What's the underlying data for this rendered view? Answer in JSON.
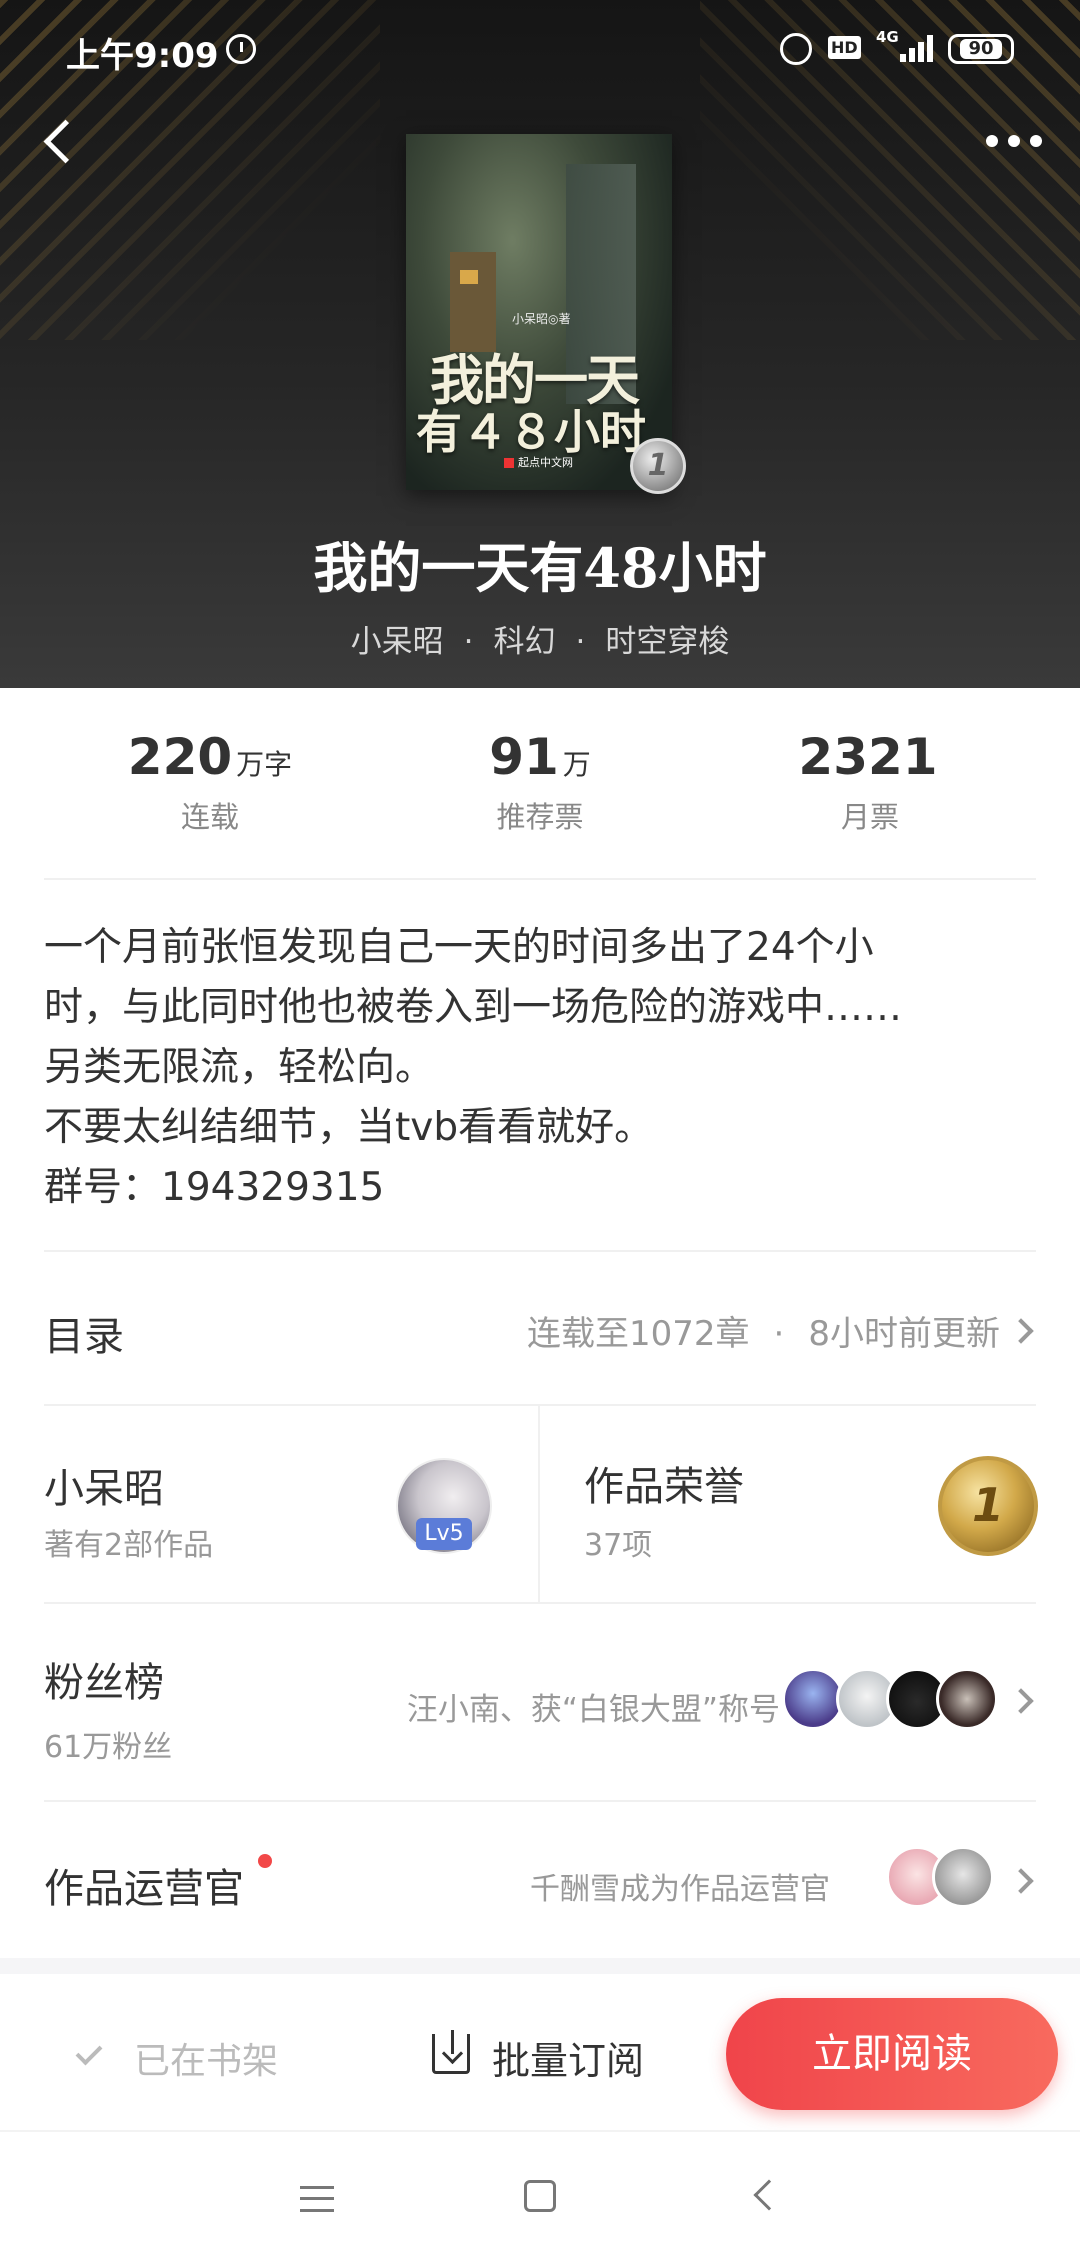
{
  "status_bar": {
    "time": "上午9:09",
    "hd": "HD",
    "network": "4G",
    "battery": "90"
  },
  "book": {
    "title": "我的一天有48小时",
    "author": "小呆昭",
    "genre": "科幻",
    "subgenre": "时空穿梭",
    "cover": {
      "author_line": "小呆昭◎著",
      "title_line1": "我的一天",
      "title_line2": "有４８小时",
      "publisher": "起点中文网",
      "badge": "1"
    }
  },
  "stats": [
    {
      "num": "220",
      "unit": "万字",
      "label": "连载"
    },
    {
      "num": "91",
      "unit": "万",
      "label": "推荐票"
    },
    {
      "num": "2321",
      "unit": "",
      "label": "月票"
    }
  ],
  "intro": [
    "一个月前张恒发现自己一天的时间多出了24个小",
    "时，与此同时他也被卷入到一场危险的游戏中……",
    "另类无限流，轻松向。",
    "不要太纠结细节，当tvb看看就好。",
    "群号：194329315"
  ],
  "catalog": {
    "title": "目录",
    "status": "连载至1072章",
    "updated": "8小时前更新"
  },
  "author_card": {
    "name": "小呆昭",
    "works": "著有2部作品",
    "level": "Lv5"
  },
  "honors": {
    "title": "作品荣誉",
    "count": "37项",
    "badge": "1"
  },
  "fans": {
    "title": "粉丝榜",
    "count": "61万粉丝",
    "note": "汪小南、获“白银大盟”称号"
  },
  "operator": {
    "title": "作品运营官",
    "note": "千酬雪成为作品运营官"
  },
  "bottom": {
    "shelf": "已在书架",
    "batch": "批量订阅",
    "read": "立即阅读"
  }
}
